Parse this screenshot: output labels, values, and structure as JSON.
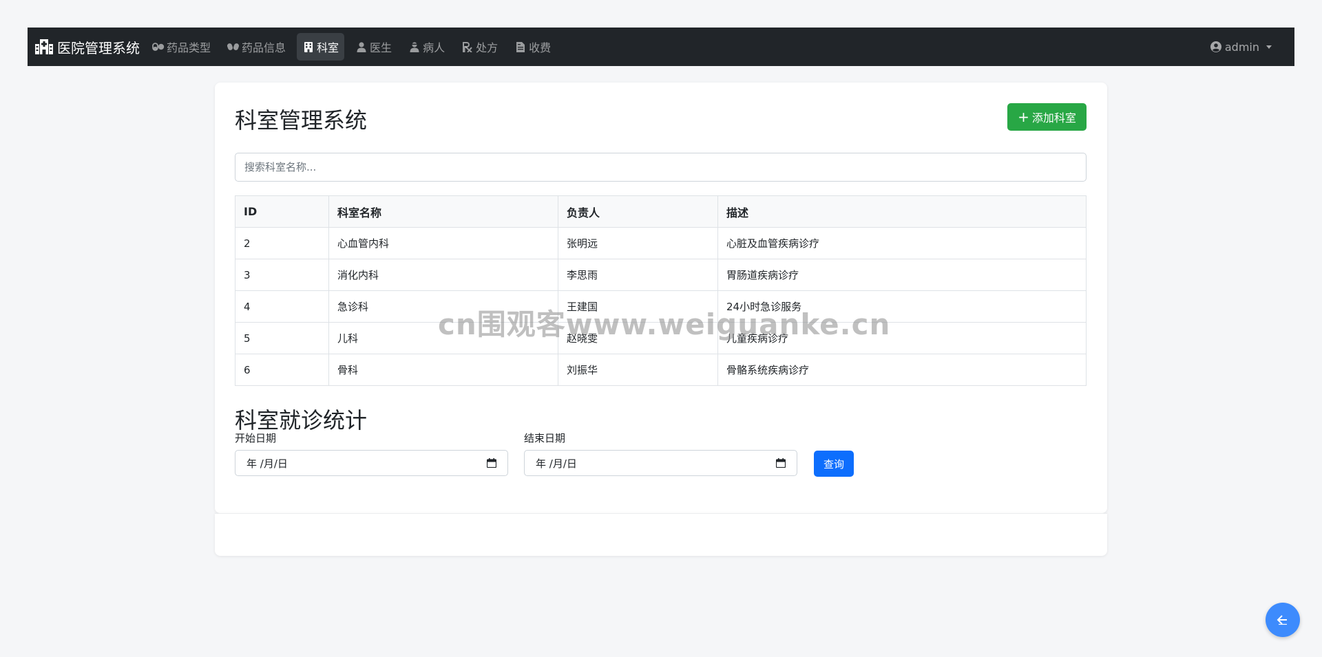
{
  "navbar": {
    "brand": "医院管理系统",
    "items": [
      {
        "label": "药品类型",
        "icon": "pills-icon",
        "active": false
      },
      {
        "label": "药品信息",
        "icon": "capsules-icon",
        "active": false
      },
      {
        "label": "科室",
        "icon": "building-icon",
        "active": true
      },
      {
        "label": "医生",
        "icon": "user-doctor-icon",
        "active": false
      },
      {
        "label": "病人",
        "icon": "user-injured-icon",
        "active": false
      },
      {
        "label": "处方",
        "icon": "prescription-icon",
        "active": false
      },
      {
        "label": "收费",
        "icon": "invoice-icon",
        "active": false
      }
    ],
    "user": "admin"
  },
  "main": {
    "title": "科室管理系统",
    "add_button": "添加科室",
    "search_placeholder": "搜索科室名称...",
    "table": {
      "headers": [
        "ID",
        "科室名称",
        "负责人",
        "描述"
      ],
      "rows": [
        [
          "2",
          "心血管内科",
          "张明远",
          "心脏及血管疾病诊疗"
        ],
        [
          "3",
          "消化内科",
          "李思雨",
          "胃肠道疾病诊疗"
        ],
        [
          "4",
          "急诊科",
          "王建国",
          "24小时急诊服务"
        ],
        [
          "5",
          "儿科",
          "赵晓雯",
          "儿童疾病诊疗"
        ],
        [
          "6",
          "骨科",
          "刘振华",
          "骨骼系统疾病诊疗"
        ]
      ]
    },
    "stats": {
      "title": "科室就诊统计",
      "start_label": "开始日期",
      "end_label": "结束日期",
      "start_value": "年 /月/日",
      "end_value": "年 /月/日",
      "query_button": "查询"
    }
  },
  "watermark": "cn围观客www.weiguanke.cn",
  "colors": {
    "navbar_bg": "#212529",
    "success": "#28a745",
    "primary": "#0d6efd",
    "fab": "#3d8bfd"
  }
}
